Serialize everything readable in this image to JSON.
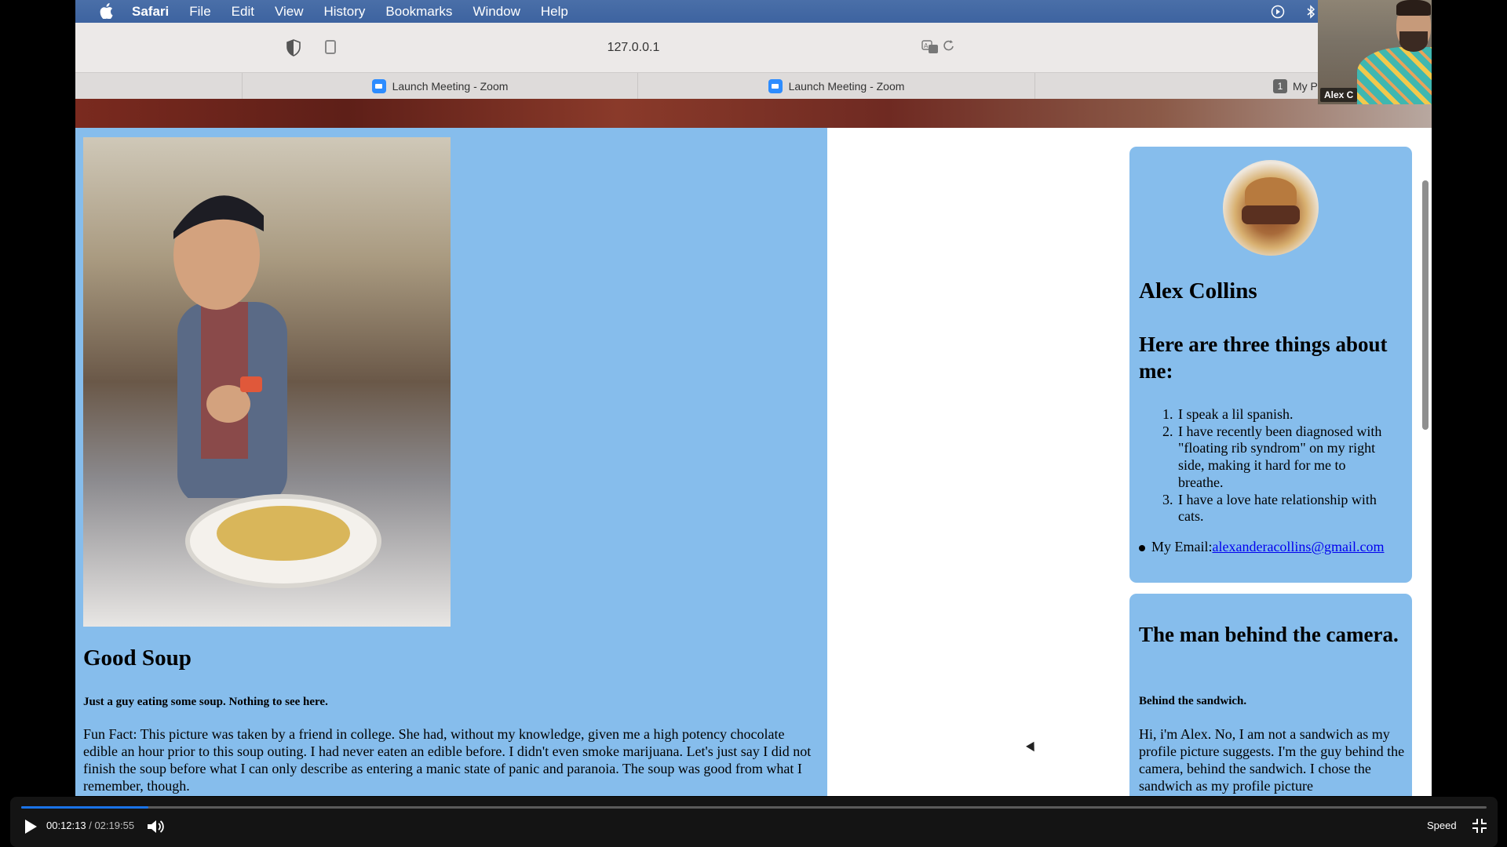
{
  "menubar": {
    "app": "Safari",
    "items": [
      "File",
      "Edit",
      "View",
      "History",
      "Bookmarks",
      "Window",
      "Help"
    ],
    "status_icons": [
      "play-circle-icon",
      "bluetooth-icon",
      "battery-icon",
      "wifi-icon",
      "spotlight-search-icon"
    ]
  },
  "toolbar": {
    "address": "127.0.0.1"
  },
  "tabs": [
    {
      "label": "Launch Meeting - Zoom"
    },
    {
      "label": "Launch Meeting - Zoom"
    },
    {
      "label": "My Po",
      "pin_number": "1"
    }
  ],
  "page": {
    "left": {
      "title": "Good Soup",
      "subtitle": "Just a guy eating some soup. Nothing to see here.",
      "fun_fact": "Fun Fact: This picture was taken by a friend in college. She had, without my knowledge, given me a high potency chocolate edible an hour prior to this soup outing. I had never eaten an edible before. I didn't even smoke marijuana. Let's just say I did not finish the soup before what I can only describe as entering a manic state of panic and paranoia. The soup was good from what I remember, though."
    },
    "profile": {
      "name": "Alex Collins",
      "things_heading": "Here are three things about me:",
      "things": [
        "I speak a lil spanish.",
        "I have recently been diagnosed with \"floating rib syndrom\" on my right side, making it hard for me to breathe.",
        "I have a love hate relationship with cats."
      ],
      "email_label": "My Email:",
      "email": "alexanderacollins@gmail.com"
    },
    "behind": {
      "heading": "The man behind the camera.",
      "subtitle": "Behind the sandwich.",
      "text": "Hi, i'm Alex. No, I am not a sandwich as my profile picture suggests. I'm the guy behind the camera, behind the sandwich. I chose the sandwich as my profile picture"
    }
  },
  "participant": {
    "name": "Alex C"
  },
  "player": {
    "current": "00:12:13",
    "separator": " / ",
    "total": "02:19:55",
    "progress": 0.087,
    "speed_label": "Speed"
  }
}
